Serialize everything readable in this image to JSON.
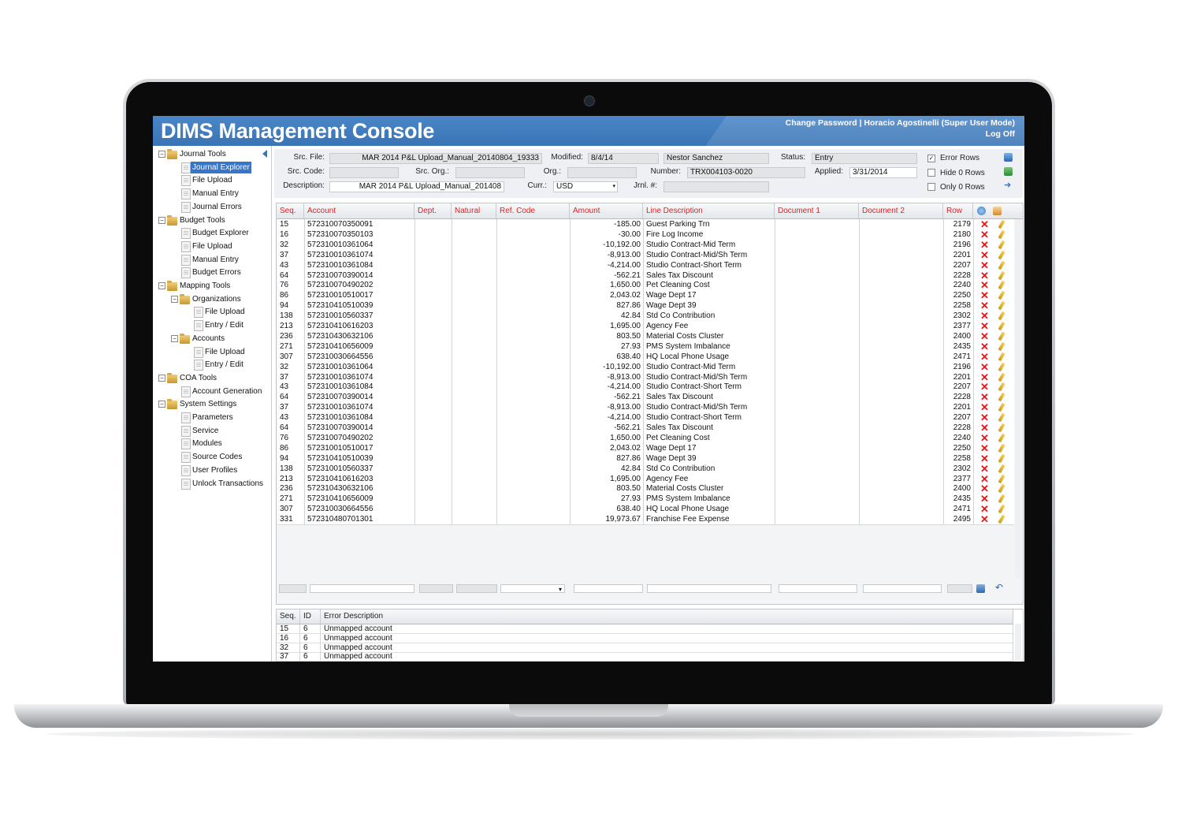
{
  "app": {
    "title": "DIMS Management Console",
    "header_links": "Change Password | Horacio Agostinelli (Super User Mode)",
    "logoff": "Log Off"
  },
  "tree": [
    {
      "label": "Journal Tools",
      "level": 0,
      "type": "folder",
      "expanded": true
    },
    {
      "label": "Journal Explorer",
      "level": 1,
      "type": "doc",
      "selected": true
    },
    {
      "label": "File Upload",
      "level": 1,
      "type": "doc"
    },
    {
      "label": "Manual Entry",
      "level": 1,
      "type": "doc"
    },
    {
      "label": "Journal Errors",
      "level": 1,
      "type": "doc"
    },
    {
      "label": "Budget Tools",
      "level": 0,
      "type": "folder",
      "expanded": true
    },
    {
      "label": "Budget Explorer",
      "level": 1,
      "type": "doc"
    },
    {
      "label": "File Upload",
      "level": 1,
      "type": "doc"
    },
    {
      "label": "Manual Entry",
      "level": 1,
      "type": "doc"
    },
    {
      "label": "Budget Errors",
      "level": 1,
      "type": "doc"
    },
    {
      "label": "Mapping Tools",
      "level": 0,
      "type": "folder",
      "expanded": true
    },
    {
      "label": "Organizations",
      "level": 1,
      "type": "folder",
      "expanded": true
    },
    {
      "label": "File Upload",
      "level": 2,
      "type": "doc"
    },
    {
      "label": "Entry / Edit",
      "level": 2,
      "type": "doc"
    },
    {
      "label": "Accounts",
      "level": 1,
      "type": "folder",
      "expanded": true
    },
    {
      "label": "File Upload",
      "level": 2,
      "type": "doc"
    },
    {
      "label": "Entry / Edit",
      "level": 2,
      "type": "doc"
    },
    {
      "label": "COA Tools",
      "level": 0,
      "type": "folder",
      "expanded": true
    },
    {
      "label": "Account Generation",
      "level": 1,
      "type": "doc"
    },
    {
      "label": "System Settings",
      "level": 0,
      "type": "folder",
      "expanded": true
    },
    {
      "label": "Parameters",
      "level": 1,
      "type": "doc"
    },
    {
      "label": "Service",
      "level": 1,
      "type": "doc"
    },
    {
      "label": "Modules",
      "level": 1,
      "type": "doc"
    },
    {
      "label": "Source Codes",
      "level": 1,
      "type": "doc"
    },
    {
      "label": "User Profiles",
      "level": 1,
      "type": "doc"
    },
    {
      "label": "Unlock Transactions",
      "level": 1,
      "type": "doc"
    }
  ],
  "form": {
    "src_file_label": "Src. File:",
    "src_file_value": "MAR 2014 P&L Upload_Manual_20140804_19333",
    "modified_label": "Modified:",
    "modified_value": "8/4/14",
    "modified_by": "Nestor Sanchez",
    "status_label": "Status:",
    "status_value": "Entry",
    "src_code_label": "Src. Code:",
    "src_code_value": "",
    "src_org_label": "Src. Org.:",
    "src_org_value": "",
    "org_label": "Org.:",
    "org_value": "",
    "number_label": "Number:",
    "number_value": "TRX004103-0020",
    "applied_label": "Applied:",
    "applied_value": "3/31/2014",
    "description_label": "Description:",
    "description_value": "MAR 2014 P&L Upload_Manual_201408",
    "curr_label": "Curr.:",
    "curr_value": "USD",
    "jrnl_label": "Jrnl. #:",
    "jrnl_value": "",
    "error_rows_label": "Error Rows",
    "hide_rows_label": "Hide 0 Rows",
    "only_rows_label": "Only 0 Rows"
  },
  "grid": {
    "columns": [
      "Seq.",
      "Account",
      "Dept.",
      "Natural",
      "Ref. Code",
      "Amount",
      "Line Description",
      "Document 1",
      "Document 2",
      "Row"
    ],
    "rows": [
      [
        "15",
        "572310070350091",
        "",
        "",
        "",
        "-185.00",
        "Guest Parking Trn",
        "",
        "",
        "2179"
      ],
      [
        "16",
        "572310070350103",
        "",
        "",
        "",
        "-30.00",
        "Fire Log Income",
        "",
        "",
        "2180"
      ],
      [
        "32",
        "572310010361064",
        "",
        "",
        "",
        "-10,192.00",
        "Studio Contract-Mid Term",
        "",
        "",
        "2196"
      ],
      [
        "37",
        "572310010361074",
        "",
        "",
        "",
        "-8,913.00",
        "Studio Contract-Mid/Sh Term",
        "",
        "",
        "2201"
      ],
      [
        "43",
        "572310010361084",
        "",
        "",
        "",
        "-4,214.00",
        "Studio Contract-Short Term",
        "",
        "",
        "2207"
      ],
      [
        "64",
        "572310070390014",
        "",
        "",
        "",
        "-562.21",
        "Sales Tax Discount",
        "",
        "",
        "2228"
      ],
      [
        "76",
        "572310070490202",
        "",
        "",
        "",
        "1,650.00",
        "Pet Cleaning Cost",
        "",
        "",
        "2240"
      ],
      [
        "86",
        "572310010510017",
        "",
        "",
        "",
        "2,043.02",
        "Wage Dept 17",
        "",
        "",
        "2250"
      ],
      [
        "94",
        "572310410510039",
        "",
        "",
        "",
        "827.86",
        "Wage Dept 39",
        "",
        "",
        "2258"
      ],
      [
        "138",
        "572310010560337",
        "",
        "",
        "",
        "42.84",
        "Std Co Contribution",
        "",
        "",
        "2302"
      ],
      [
        "213",
        "572310410616203",
        "",
        "",
        "",
        "1,695.00",
        "Agency Fee",
        "",
        "",
        "2377"
      ],
      [
        "236",
        "572310430632106",
        "",
        "",
        "",
        "803.50",
        "Material Costs Cluster",
        "",
        "",
        "2400"
      ],
      [
        "271",
        "572310410656009",
        "",
        "",
        "",
        "27.93",
        "PMS System Imbalance",
        "",
        "",
        "2435"
      ],
      [
        "307",
        "572310030664556",
        "",
        "",
        "",
        "638.40",
        "HQ Local Phone Usage",
        "",
        "",
        "2471"
      ],
      [
        "32",
        "572310010361064",
        "",
        "",
        "",
        "-10,192.00",
        "Studio Contract-Mid Term",
        "",
        "",
        "2196"
      ],
      [
        "37",
        "572310010361074",
        "",
        "",
        "",
        "-8,913.00",
        "Studio Contract-Mid/Sh Term",
        "",
        "",
        "2201"
      ],
      [
        "43",
        "572310010361084",
        "",
        "",
        "",
        "-4,214.00",
        "Studio Contract-Short Term",
        "",
        "",
        "2207"
      ],
      [
        "64",
        "572310070390014",
        "",
        "",
        "",
        "-562.21",
        "Sales Tax Discount",
        "",
        "",
        "2228"
      ],
      [
        "37",
        "572310010361074",
        "",
        "",
        "",
        "-8,913.00",
        "Studio Contract-Mid/Sh Term",
        "",
        "",
        "2201"
      ],
      [
        "43",
        "572310010361084",
        "",
        "",
        "",
        "-4,214.00",
        "Studio Contract-Short Term",
        "",
        "",
        "2207"
      ],
      [
        "64",
        "572310070390014",
        "",
        "",
        "",
        "-562.21",
        "Sales Tax Discount",
        "",
        "",
        "2228"
      ],
      [
        "76",
        "572310070490202",
        "",
        "",
        "",
        "1,650.00",
        "Pet Cleaning Cost",
        "",
        "",
        "2240"
      ],
      [
        "86",
        "572310010510017",
        "",
        "",
        "",
        "2,043.02",
        "Wage Dept 17",
        "",
        "",
        "2250"
      ],
      [
        "94",
        "572310410510039",
        "",
        "",
        "",
        "827.86",
        "Wage Dept 39",
        "",
        "",
        "2258"
      ],
      [
        "138",
        "572310010560337",
        "",
        "",
        "",
        "42.84",
        "Std Co Contribution",
        "",
        "",
        "2302"
      ],
      [
        "213",
        "572310410616203",
        "",
        "",
        "",
        "1,695.00",
        "Agency Fee",
        "",
        "",
        "2377"
      ],
      [
        "236",
        "572310430632106",
        "",
        "",
        "",
        "803.50",
        "Material Costs Cluster",
        "",
        "",
        "2400"
      ],
      [
        "271",
        "572310410656009",
        "",
        "",
        "",
        "27.93",
        "PMS System Imbalance",
        "",
        "",
        "2435"
      ],
      [
        "307",
        "572310030664556",
        "",
        "",
        "",
        "638.40",
        "HQ Local Phone Usage",
        "",
        "",
        "2471"
      ],
      [
        "331",
        "572310480701301",
        "",
        "",
        "",
        "19,973.67",
        "Franchise Fee Expense",
        "",
        "",
        "2495"
      ]
    ]
  },
  "errors": {
    "columns": [
      "Seq.",
      "ID",
      "Error Description"
    ],
    "rows": [
      [
        "15",
        "6",
        "Unmapped account"
      ],
      [
        "16",
        "6",
        "Unmapped account"
      ],
      [
        "32",
        "6",
        "Unmapped account"
      ],
      [
        "37",
        "6",
        "Unmapped account"
      ]
    ]
  },
  "icons": {
    "save": "save-icon",
    "export": "excel-export-icon",
    "arrow": "arrow-right-icon",
    "refresh": "refresh-icon",
    "columns": "column-chooser-icon",
    "delete": "delete-icon",
    "edit": "pencil-icon",
    "undo": "undo-icon"
  },
  "colors": {
    "header_blue": "#3a74b5",
    "column_header_red": "#d22222",
    "selection_blue": "#3875c6"
  }
}
